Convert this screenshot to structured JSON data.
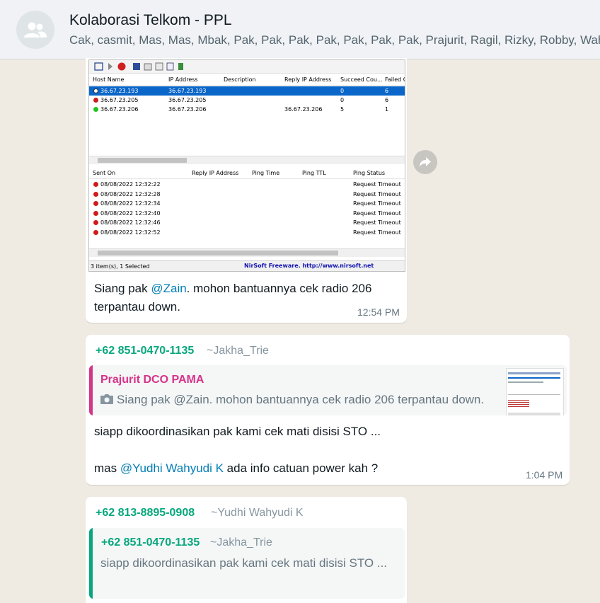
{
  "header": {
    "title": "Kolaborasi Telkom - PPL",
    "members": "Cak, casmit, Mas, Mas, Mbak, Pak, Pak, Pak, Pak, Pak, Pak, Pak, Prajurit, Ragil, Rizky, Robby, Wahyu, Yudhi"
  },
  "screenshot": {
    "hosts_columns": [
      "Host Name",
      "IP Address",
      "Description",
      "Reply IP Address",
      "Succeed Cou...",
      "Failed C"
    ],
    "hosts": [
      {
        "host": "36.67.23.193",
        "ip": "36.67.23.193",
        "desc": "",
        "reply": "",
        "succeed": "0",
        "failed": "6",
        "status": "selected"
      },
      {
        "host": "36.67.23.205",
        "ip": "36.67.23.205",
        "desc": "",
        "reply": "",
        "succeed": "0",
        "failed": "6",
        "status": "red"
      },
      {
        "host": "36.67.23.206",
        "ip": "36.67.23.206",
        "desc": "",
        "reply": "36.67.23.206",
        "succeed": "5",
        "failed": "1",
        "status": "green"
      }
    ],
    "log_columns": [
      "Sent On",
      "Reply IP Address",
      "Ping Time",
      "Ping TTL",
      "Ping Status"
    ],
    "log": [
      {
        "sent": "08/08/2022 12:32:22",
        "status": "Request Timeout"
      },
      {
        "sent": "08/08/2022 12:32:28",
        "status": "Request Timeout"
      },
      {
        "sent": "08/08/2022 12:32:34",
        "status": "Request Timeout"
      },
      {
        "sent": "08/08/2022 12:32:40",
        "status": "Request Timeout"
      },
      {
        "sent": "08/08/2022 12:32:46",
        "status": "Request Timeout"
      },
      {
        "sent": "08/08/2022 12:32:52",
        "status": "Request Timeout"
      }
    ],
    "status_left": "3 item(s), 1 Selected",
    "status_right": "NirSoft Freeware.  http://www.nirsoft.net"
  },
  "messages": [
    {
      "caption_before": "Siang pak ",
      "mention": "@Zain",
      "caption_after": ". mohon bantuannya cek radio 206 terpantau down.",
      "time": "12:54 PM"
    },
    {
      "sender_phone": "+62 851-0470-1135",
      "sender_name": "~Jakha_Trie",
      "quote_author": "Prajurit DCO PAMA",
      "quote_text": "Siang pak @Zain. mohon bantuannya cek radio 206 terpantau down.",
      "line1": "siapp dikoordinasikan pak kami cek mati disisi STO ...",
      "line2_before": "mas ",
      "line2_mention": "@Yudhi Wahyudi K",
      "line2_after": " ada info catuan power kah ?",
      "time": "1:04 PM"
    },
    {
      "sender_phone": "+62 813-8895-0908",
      "sender_name": "~Yudhi Wahyudi K",
      "quote_phone": "+62 851-0470-1135",
      "quote_name": "~Jakha_Trie",
      "quote_text": "siapp dikoordinasikan pak kami cek mati disisi STO ..."
    }
  ],
  "colors": {
    "accent_green": "#06a77d",
    "mention_blue": "#027eb5",
    "quote_pink": "#d6338a",
    "quote_teal": "#06a77d",
    "background": "#efeae2"
  }
}
